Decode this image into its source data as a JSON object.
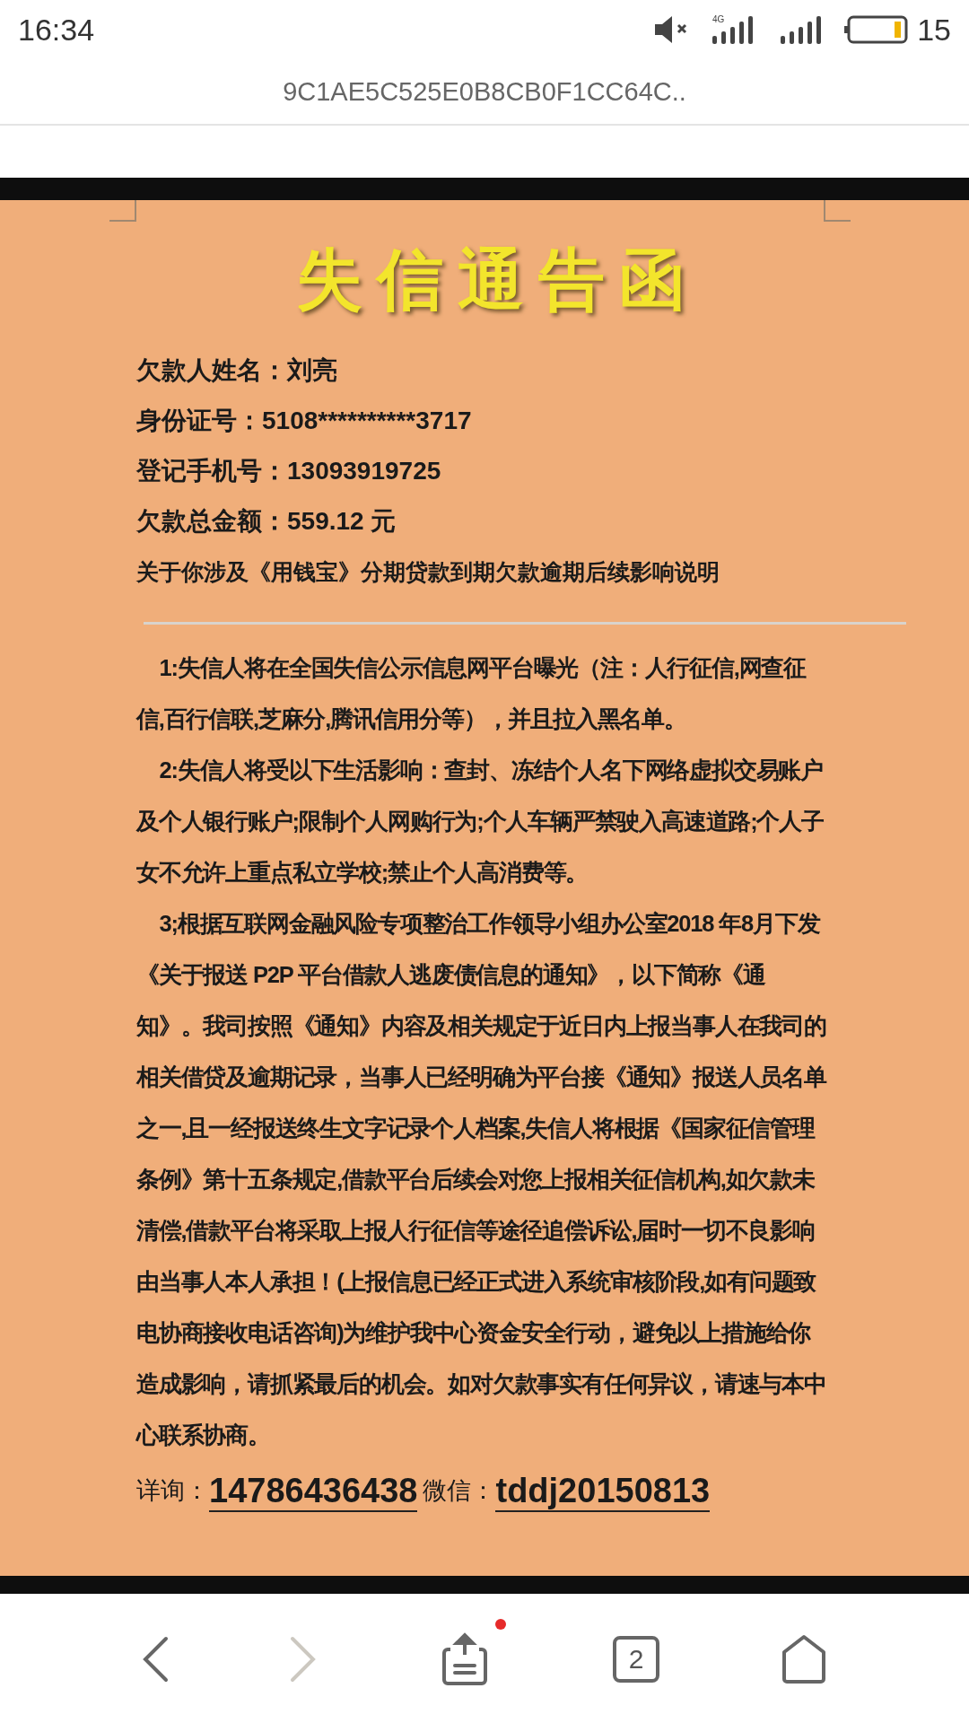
{
  "status_bar": {
    "time": "16:34",
    "network": "4G",
    "battery": "15"
  },
  "address_bar": {
    "title": "9C1AE5C525E0B8CB0F1CC64C.."
  },
  "document": {
    "title": "失信通告函",
    "fields": [
      "欠款人姓名：刘亮",
      "身份证号：5108**********3717",
      "登记手机号：13093919725",
      "欠款总金额：559.12 元"
    ],
    "subject": "关于你涉及《用钱宝》分期贷款到期欠款逾期后续影响说明",
    "paragraphs": [
      "1:失信人将在全国失信公示信息网平台曝光（注：人行征信,网查征信,百行信联,芝麻分,腾讯信用分等），并且拉入黑名单。",
      "2:失信人将受以下生活影响：查封、冻结个人名下网络虚拟交易账户及个人银行账户;限制个人网购行为;个人车辆严禁驶入高速道路;个人子女不允许上重点私立学校;禁止个人高消费等。",
      "3;根据互联网金融风险专项整治工作领导小组办公室2018 年8月下发《关于报送 P2P 平台借款人逃废债信息的通知》，以下简称《通知》。我司按照《通知》内容及相关规定于近日内上报当事人在我司的相关借贷及逾期记录，当事人已经明确为平台接《通知》报送人员名单之一,且一经报送终生文字记录个人档案,失信人将根据《国家征信管理条例》第十五条规定,借款平台后续会对您上报相关征信机构,如欠款未清偿,借款平台将采取上报人行征信等途径追偿诉讼,届时一切不良影响由当事人本人承担！(上报信息已经正式进入系统审核阶段,如有问题致电协商接收电话咨询)为维护我中心资金安全行动，避免以上措施给你造成影响，请抓紧最后的机会。如对欠款事实有任何异议，请速与本中心联系协商。"
    ],
    "contact": {
      "phone_label": "详询：",
      "phone": "14786436438",
      "wechat_label": "微信：",
      "wechat": "tddj20150813"
    }
  },
  "toolbar": {
    "forward_disabled": true,
    "share_badge": true,
    "tab_count": "2"
  }
}
